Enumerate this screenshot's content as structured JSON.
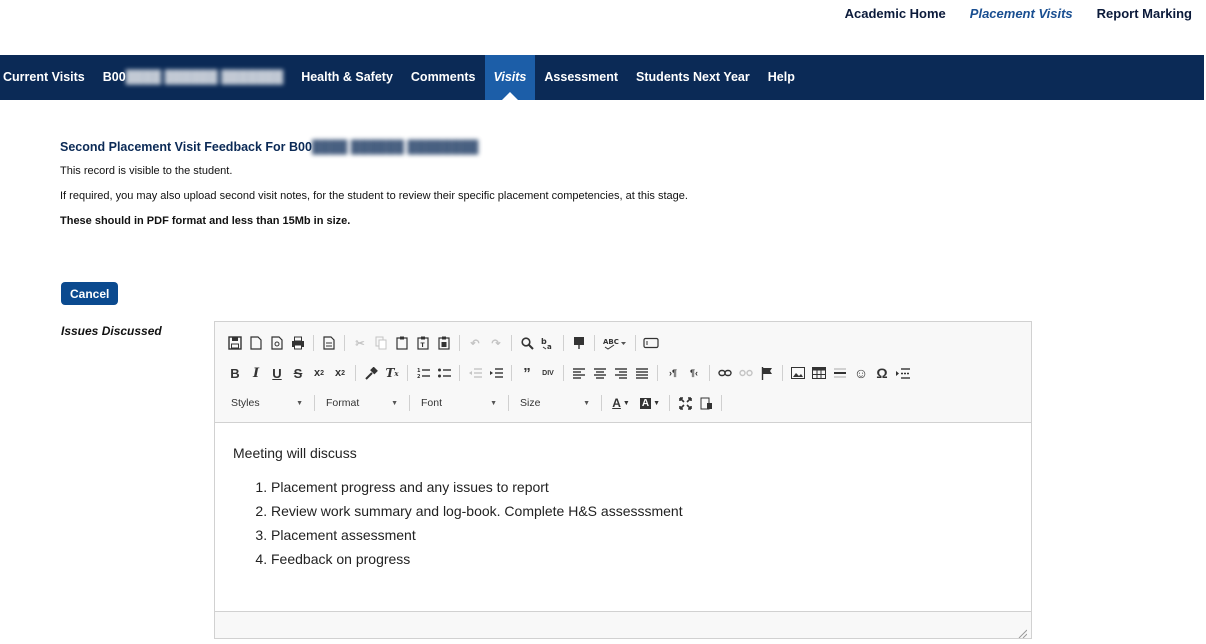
{
  "top_links": [
    {
      "label": "Academic Home"
    },
    {
      "label": "Placement Visits"
    },
    {
      "label": "Report Marking"
    }
  ],
  "nav": {
    "items": [
      {
        "label": "Current Visits"
      },
      {
        "label": "B00"
      },
      {
        "label": "Health & Safety"
      },
      {
        "label": "Comments"
      },
      {
        "label": "Visits"
      },
      {
        "label": "Assessment"
      },
      {
        "label": "Students Next Year"
      },
      {
        "label": "Help"
      }
    ],
    "active": "Visits"
  },
  "page": {
    "heading": "Second Placement Visit Feedback For B00",
    "visibility_note": "This record is visible to the student.",
    "upload_note": "If required, you may also upload second visit notes, for the student to review their specific placement competencies, at this stage.",
    "format_note": "These should in PDF format and less than 15Mb in size.",
    "cancel_label": "Cancel",
    "field_label": "Issues Discussed"
  },
  "editor": {
    "toolbar": {
      "styles_label": "Styles",
      "format_label": "Format",
      "font_label": "Font",
      "size_label": "Size"
    },
    "content": {
      "intro": "Meeting will discuss",
      "items": [
        "Placement progress and any issues to report",
        "Review work summary and log-book. Complete H&S assesssment",
        "Placement assessment",
        "Feedback on progress"
      ]
    }
  },
  "colors": {
    "navbar": "#0b2a56",
    "nav_active": "#1c5ea8",
    "button": "#0b4a8f"
  }
}
